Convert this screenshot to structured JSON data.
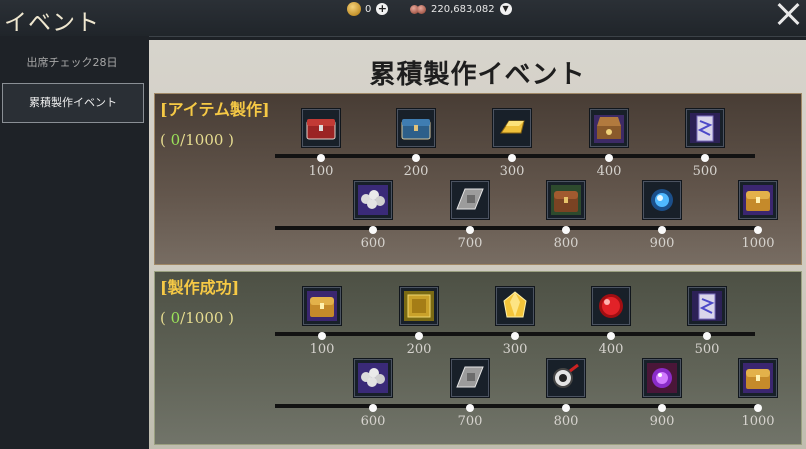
{
  "window": {
    "title": "イベント"
  },
  "currency": {
    "gold": {
      "icon": "gold-coin-icon",
      "value": "0"
    },
    "silver": {
      "icon": "silver-coin-icon",
      "value": "220,683,082"
    }
  },
  "sidebar": {
    "items": [
      {
        "label": "出席チェック28日",
        "selected": false
      },
      {
        "label": "累積製作イベント",
        "selected": true
      }
    ]
  },
  "main": {
    "title": "累積製作イベント",
    "sections": [
      {
        "title": "[アイテム製作]",
        "progress_open": "( ",
        "progress_current": "0",
        "progress_total": "/1000 )",
        "rows": [
          [
            {
              "threshold": "100",
              "icon": "red-chest-icon"
            },
            {
              "threshold": "200",
              "icon": "blue-chest-icon"
            },
            {
              "threshold": "300",
              "icon": "gold-ingot-icon"
            },
            {
              "threshold": "400",
              "icon": "open-purple-chest-icon"
            },
            {
              "threshold": "500",
              "icon": "purple-tag-icon"
            }
          ],
          [
            {
              "threshold": "600",
              "icon": "silver-pile-icon"
            },
            {
              "threshold": "700",
              "icon": "silver-ticket-icon"
            },
            {
              "threshold": "800",
              "icon": "wooden-chest-icon"
            },
            {
              "threshold": "900",
              "icon": "blue-orb-icon"
            },
            {
              "threshold": "1000",
              "icon": "gold-chest-icon"
            }
          ]
        ]
      },
      {
        "title": "[製作成功]",
        "progress_open": "( ",
        "progress_current": "0",
        "progress_total": "/1000 )",
        "rows": [
          [
            {
              "threshold": "100",
              "icon": "gold-chest-icon"
            },
            {
              "threshold": "200",
              "icon": "gold-book-icon"
            },
            {
              "threshold": "300",
              "icon": "yellow-crystal-icon"
            },
            {
              "threshold": "400",
              "icon": "red-orb-icon"
            },
            {
              "threshold": "500",
              "icon": "purple-tag-icon"
            }
          ],
          [
            {
              "threshold": "600",
              "icon": "silver-pile-icon"
            },
            {
              "threshold": "700",
              "icon": "silver-ticket-icon"
            },
            {
              "threshold": "800",
              "icon": "magnifier-icon"
            },
            {
              "threshold": "900",
              "icon": "purple-orb-icon"
            },
            {
              "threshold": "1000",
              "icon": "gold-chest-icon"
            }
          ]
        ]
      }
    ]
  },
  "colors": {
    "section_title": "#f6c945",
    "progress_current": "#9be35a"
  }
}
